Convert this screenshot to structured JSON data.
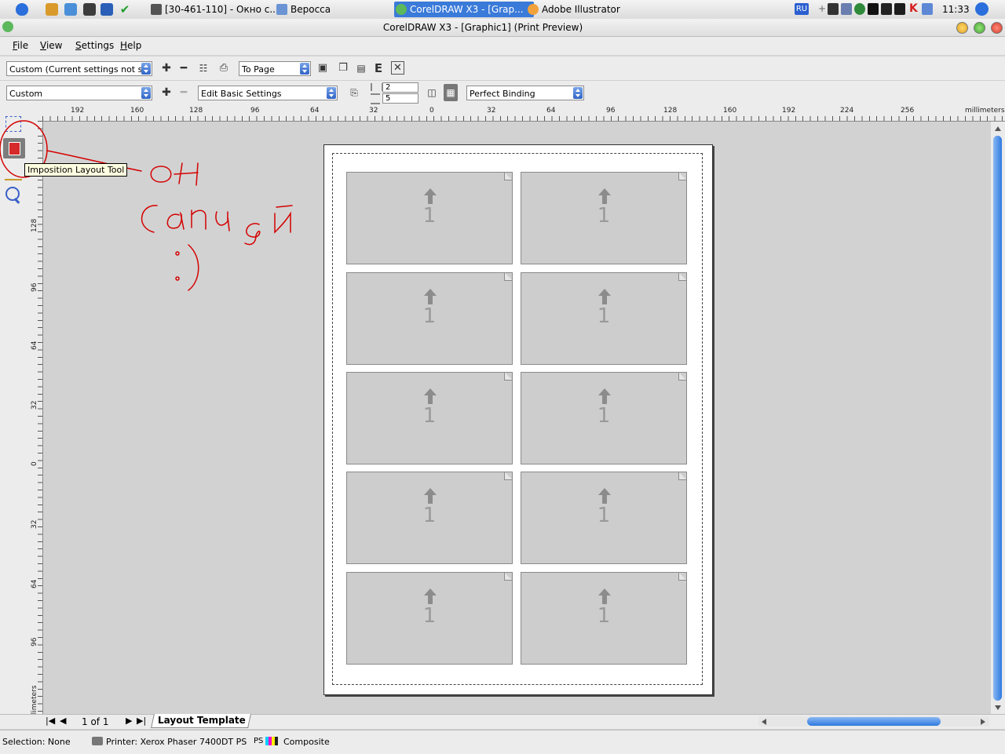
{
  "taskbar": {
    "tasks": [
      "[30-461-110] - Окно с...",
      "Веросса",
      "CorelDRAW X3 - [Grap...",
      "Adobe Illustrator"
    ],
    "language": "RU",
    "clock": "11:33"
  },
  "window": {
    "title": "CorelDRAW X3 - [Graphic1] (Print Preview)"
  },
  "menu": {
    "items": [
      "File",
      "View",
      "Settings",
      "Help"
    ]
  },
  "toolbar1": {
    "print_style": "Custom (Current settings not s...",
    "zoom": "To Page",
    "e_label": "E"
  },
  "toolbar2": {
    "layout": "Custom",
    "edit_settings": "Edit Basic Settings",
    "columns": "2",
    "rows": "5",
    "binding": "Perfect Binding"
  },
  "ruler": {
    "unit": "millimeters",
    "h_labels": [
      "192",
      "160",
      "128",
      "96",
      "64",
      "32",
      "0",
      "32",
      "64",
      "96",
      "128",
      "160",
      "192",
      "224",
      "256"
    ],
    "v_labels": [
      "128",
      "96",
      "64",
      "32",
      "0",
      "32",
      "64",
      "96"
    ]
  },
  "tooltip": "Imposition Layout Tool",
  "annotation": {
    "color": "#d40000"
  },
  "cards": [
    "1",
    "1",
    "1",
    "1",
    "1",
    "1",
    "1",
    "1",
    "1",
    "1"
  ],
  "page_nav": {
    "label": "1 of 1",
    "tab": "Layout Template"
  },
  "status": {
    "selection": "Selection: None",
    "printer": "Printer: Xerox Phaser 7400DT PS",
    "ps": "PS",
    "composite": "Composite"
  },
  "colors": {
    "accent": "#3a7ad9",
    "taskbar_active": "#3a7ad9",
    "scroll": "#2e7ae0"
  }
}
